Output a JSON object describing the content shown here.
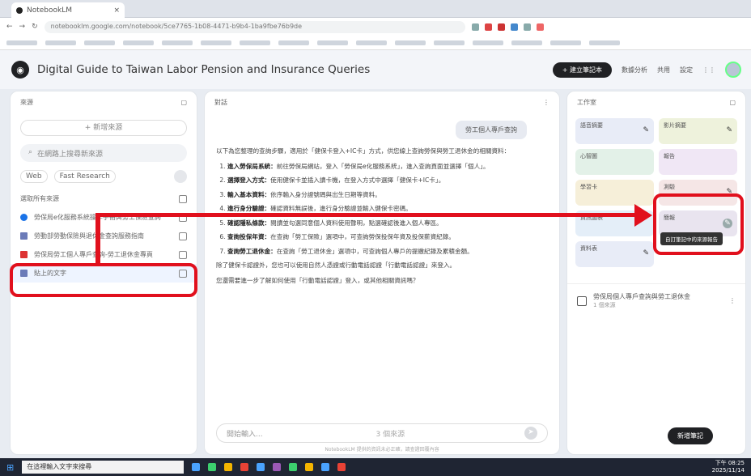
{
  "browser": {
    "tab_title": "NotebookLM",
    "url": "notebooklm.google.com/notebook/5ce7765-1b08-4471-b9b4-1ba9fbe76b9de"
  },
  "app": {
    "title": "Digital Guide to Taiwan Labor Pension and Insurance Queries",
    "create_button": "+ 建立筆記本",
    "share_label": "共用",
    "settings_label": "設定",
    "analytics_label": "數據分析"
  },
  "sources_panel": {
    "title": "來源",
    "add_button": "+ 新增來源",
    "search_placeholder": "在網路上搜尋新來源",
    "filter_web": "Web",
    "filter_research": "Fast Research",
    "select_all": "選取所有來源",
    "items": [
      {
        "label": "勞保局e化服務系統操作手冊與勞工保險查詢",
        "icon": "web-icon"
      },
      {
        "label": "勞動部勞動保險與退休金查詢服務指南",
        "icon": "doc-icon"
      },
      {
        "label": "勞保局勞工個人專戶查詢-勞工退休金專頁",
        "icon": "pdf-icon"
      },
      {
        "label": "貼上的文字",
        "icon": "doc-icon"
      }
    ]
  },
  "chat_panel": {
    "title": "對話",
    "user_bubble": "勞工個人專戶查詢",
    "intro": "以下為您整理的查詢步驟，適用於「健保卡登入+IC卡」方式，供您線上查詢勞保與勞工退休金的相關資料：",
    "steps": [
      {
        "bold": "進入勞保局系統：",
        "text": "前往勞保局網站，登入「勞保局e化服務系統」，進入查詢頁面並選擇「個人」。"
      },
      {
        "bold": "選擇登入方式：",
        "text": "使用健保卡並插入讀卡機，在登入方式中選擇「健保卡+IC卡」。"
      },
      {
        "bold": "輸入基本資料：",
        "text": "依序輸入身分證號碼與出生日期等資料。"
      },
      {
        "bold": "進行身分驗證：",
        "text": "確認資料無誤後，進行身分驗證並輸入健保卡密碼。"
      },
      {
        "bold": "確認隱私條款：",
        "text": "閱讀並勾選同意個人資料使用聲明，點選確認後進入個人專區。"
      },
      {
        "bold": "查詢投保年資：",
        "text": "在查詢「勞工保險」選項中，可查詢勞保投保年資及投保薪資紀錄。"
      },
      {
        "bold": "查詢勞工退休金：",
        "text": "在查詢「勞工退休金」選項中，可查詢個人專戶的提繳紀錄及累積金額。"
      }
    ],
    "outro": "除了健保卡認證外，您也可以使用自然人憑證或行動電話認證「行動電話認證」來登入。",
    "question": "您還需要進一步了解如何使用「行動電話認證」登入，或其他相關資訊嗎？",
    "input_placeholder": "開始輸入...",
    "source_count": "3 個來源",
    "footer": "NotebookLM 提供的資訊未必正確，請查證回覆內容"
  },
  "studio_panel": {
    "title": "工作室",
    "tiles": [
      {
        "label": "語音摘要"
      },
      {
        "label": "影片摘要"
      },
      {
        "label": "心智圖"
      },
      {
        "label": "報告"
      },
      {
        "label": "學習卡"
      },
      {
        "label": "測驗"
      },
      {
        "label": "資訊圖表"
      },
      {
        "label": "簡報"
      },
      {
        "label": "資料表"
      }
    ],
    "tooltip": "自訂筆記中的來源報告",
    "note_title": "勞保局個人專戶查詢與勞工退休金",
    "note_sub": "1 個來源",
    "add_note": "新增筆記"
  },
  "taskbar": {
    "search_placeholder": "在這裡輸入文字來搜尋",
    "time": "下午 08:25",
    "date": "2025/11/14"
  }
}
